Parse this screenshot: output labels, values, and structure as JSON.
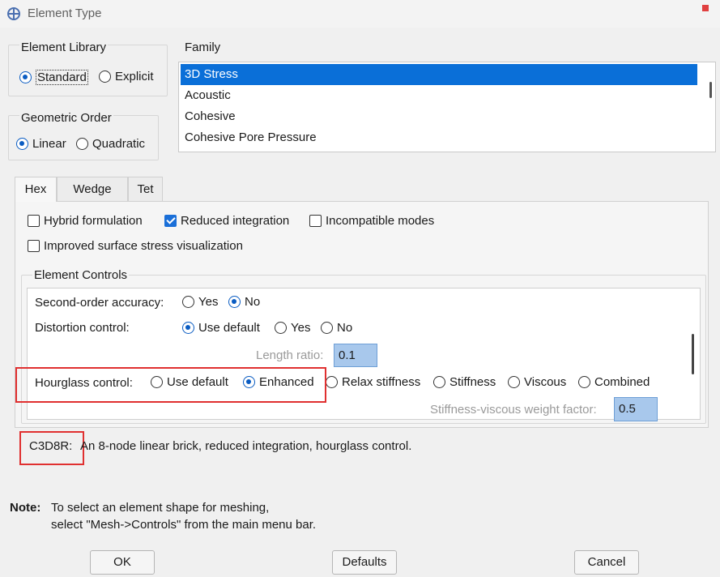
{
  "window": {
    "title": "Element Type"
  },
  "element_library": {
    "title": "Element Library",
    "options": [
      "Standard",
      "Explicit"
    ],
    "selected": "Standard"
  },
  "family": {
    "title": "Family",
    "items": [
      "3D Stress",
      "Acoustic",
      "Cohesive",
      "Cohesive Pore Pressure"
    ],
    "selected": "3D Stress"
  },
  "geometric_order": {
    "title": "Geometric Order",
    "options": [
      "Linear",
      "Quadratic"
    ],
    "selected": "Linear"
  },
  "tabs": [
    "Hex",
    "Wedge",
    "Tet"
  ],
  "active_tab": "Hex",
  "options": {
    "hybrid": {
      "label": "Hybrid formulation",
      "checked": false
    },
    "reduced": {
      "label": "Reduced integration",
      "checked": true
    },
    "incompatible": {
      "label": "Incompatible modes",
      "checked": false
    },
    "improved": {
      "label": "Improved surface stress visualization",
      "checked": false
    }
  },
  "element_controls": {
    "title": "Element Controls",
    "second_order": {
      "label": "Second-order accuracy:",
      "options": [
        "Yes",
        "No"
      ],
      "selected": "No"
    },
    "distortion": {
      "label": "Distortion control:",
      "options": [
        "Use default",
        "Yes",
        "No"
      ],
      "selected": "Use default"
    },
    "length_ratio": {
      "label": "Length ratio:",
      "value": "0.1"
    },
    "hourglass": {
      "label": "Hourglass control:",
      "options": [
        "Use default",
        "Enhanced",
        "Relax stiffness",
        "Stiffness",
        "Viscous",
        "Combined"
      ],
      "selected": "Enhanced"
    },
    "stiffness_weight": {
      "label": "Stiffness-viscous weight factor:",
      "value": "0.5"
    }
  },
  "description": {
    "code": "C3D8R:",
    "text": "An 8-node linear brick, reduced integration, hourglass control."
  },
  "note": {
    "label": "Note:",
    "line1": "To select an element shape for meshing,",
    "line2": "select \"Mesh->Controls\" from the main menu bar."
  },
  "buttons": {
    "ok": "OK",
    "defaults": "Defaults",
    "cancel": "Cancel"
  },
  "colors": {
    "selection": "#0a6fd8",
    "highlight_box": "#e03030",
    "value_field": "#a8c8ec"
  }
}
